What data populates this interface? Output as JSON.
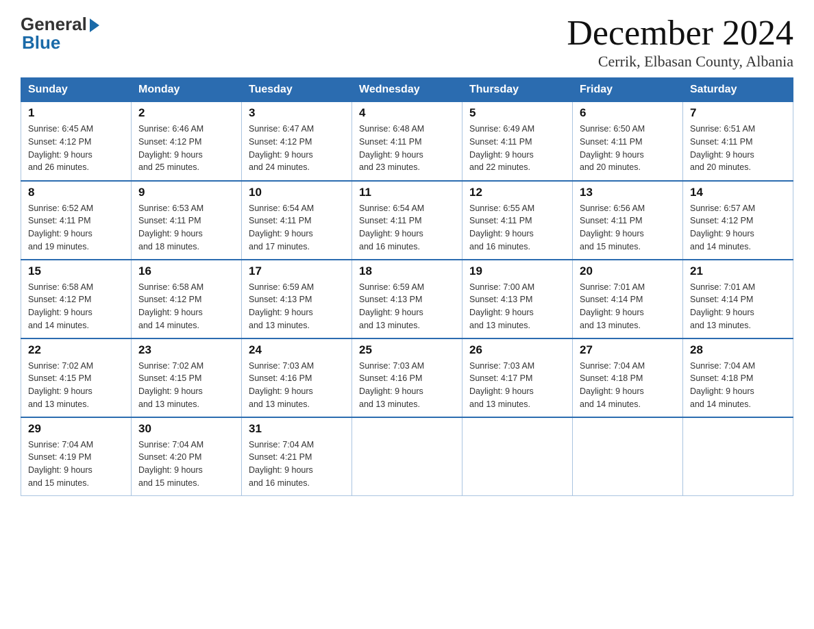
{
  "logo": {
    "general": "General",
    "blue": "Blue"
  },
  "title": {
    "month": "December 2024",
    "location": "Cerrik, Elbasan County, Albania"
  },
  "headers": [
    "Sunday",
    "Monday",
    "Tuesday",
    "Wednesday",
    "Thursday",
    "Friday",
    "Saturday"
  ],
  "weeks": [
    [
      {
        "day": "1",
        "sunrise": "6:45 AM",
        "sunset": "4:12 PM",
        "daylight": "9 hours and 26 minutes."
      },
      {
        "day": "2",
        "sunrise": "6:46 AM",
        "sunset": "4:12 PM",
        "daylight": "9 hours and 25 minutes."
      },
      {
        "day": "3",
        "sunrise": "6:47 AM",
        "sunset": "4:12 PM",
        "daylight": "9 hours and 24 minutes."
      },
      {
        "day": "4",
        "sunrise": "6:48 AM",
        "sunset": "4:11 PM",
        "daylight": "9 hours and 23 minutes."
      },
      {
        "day": "5",
        "sunrise": "6:49 AM",
        "sunset": "4:11 PM",
        "daylight": "9 hours and 22 minutes."
      },
      {
        "day": "6",
        "sunrise": "6:50 AM",
        "sunset": "4:11 PM",
        "daylight": "9 hours and 20 minutes."
      },
      {
        "day": "7",
        "sunrise": "6:51 AM",
        "sunset": "4:11 PM",
        "daylight": "9 hours and 20 minutes."
      }
    ],
    [
      {
        "day": "8",
        "sunrise": "6:52 AM",
        "sunset": "4:11 PM",
        "daylight": "9 hours and 19 minutes."
      },
      {
        "day": "9",
        "sunrise": "6:53 AM",
        "sunset": "4:11 PM",
        "daylight": "9 hours and 18 minutes."
      },
      {
        "day": "10",
        "sunrise": "6:54 AM",
        "sunset": "4:11 PM",
        "daylight": "9 hours and 17 minutes."
      },
      {
        "day": "11",
        "sunrise": "6:54 AM",
        "sunset": "4:11 PM",
        "daylight": "9 hours and 16 minutes."
      },
      {
        "day": "12",
        "sunrise": "6:55 AM",
        "sunset": "4:11 PM",
        "daylight": "9 hours and 16 minutes."
      },
      {
        "day": "13",
        "sunrise": "6:56 AM",
        "sunset": "4:11 PM",
        "daylight": "9 hours and 15 minutes."
      },
      {
        "day": "14",
        "sunrise": "6:57 AM",
        "sunset": "4:12 PM",
        "daylight": "9 hours and 14 minutes."
      }
    ],
    [
      {
        "day": "15",
        "sunrise": "6:58 AM",
        "sunset": "4:12 PM",
        "daylight": "9 hours and 14 minutes."
      },
      {
        "day": "16",
        "sunrise": "6:58 AM",
        "sunset": "4:12 PM",
        "daylight": "9 hours and 14 minutes."
      },
      {
        "day": "17",
        "sunrise": "6:59 AM",
        "sunset": "4:13 PM",
        "daylight": "9 hours and 13 minutes."
      },
      {
        "day": "18",
        "sunrise": "6:59 AM",
        "sunset": "4:13 PM",
        "daylight": "9 hours and 13 minutes."
      },
      {
        "day": "19",
        "sunrise": "7:00 AM",
        "sunset": "4:13 PM",
        "daylight": "9 hours and 13 minutes."
      },
      {
        "day": "20",
        "sunrise": "7:01 AM",
        "sunset": "4:14 PM",
        "daylight": "9 hours and 13 minutes."
      },
      {
        "day": "21",
        "sunrise": "7:01 AM",
        "sunset": "4:14 PM",
        "daylight": "9 hours and 13 minutes."
      }
    ],
    [
      {
        "day": "22",
        "sunrise": "7:02 AM",
        "sunset": "4:15 PM",
        "daylight": "9 hours and 13 minutes."
      },
      {
        "day": "23",
        "sunrise": "7:02 AM",
        "sunset": "4:15 PM",
        "daylight": "9 hours and 13 minutes."
      },
      {
        "day": "24",
        "sunrise": "7:03 AM",
        "sunset": "4:16 PM",
        "daylight": "9 hours and 13 minutes."
      },
      {
        "day": "25",
        "sunrise": "7:03 AM",
        "sunset": "4:16 PM",
        "daylight": "9 hours and 13 minutes."
      },
      {
        "day": "26",
        "sunrise": "7:03 AM",
        "sunset": "4:17 PM",
        "daylight": "9 hours and 13 minutes."
      },
      {
        "day": "27",
        "sunrise": "7:04 AM",
        "sunset": "4:18 PM",
        "daylight": "9 hours and 14 minutes."
      },
      {
        "day": "28",
        "sunrise": "7:04 AM",
        "sunset": "4:18 PM",
        "daylight": "9 hours and 14 minutes."
      }
    ],
    [
      {
        "day": "29",
        "sunrise": "7:04 AM",
        "sunset": "4:19 PM",
        "daylight": "9 hours and 15 minutes."
      },
      {
        "day": "30",
        "sunrise": "7:04 AM",
        "sunset": "4:20 PM",
        "daylight": "9 hours and 15 minutes."
      },
      {
        "day": "31",
        "sunrise": "7:04 AM",
        "sunset": "4:21 PM",
        "daylight": "9 hours and 16 minutes."
      },
      null,
      null,
      null,
      null
    ]
  ]
}
